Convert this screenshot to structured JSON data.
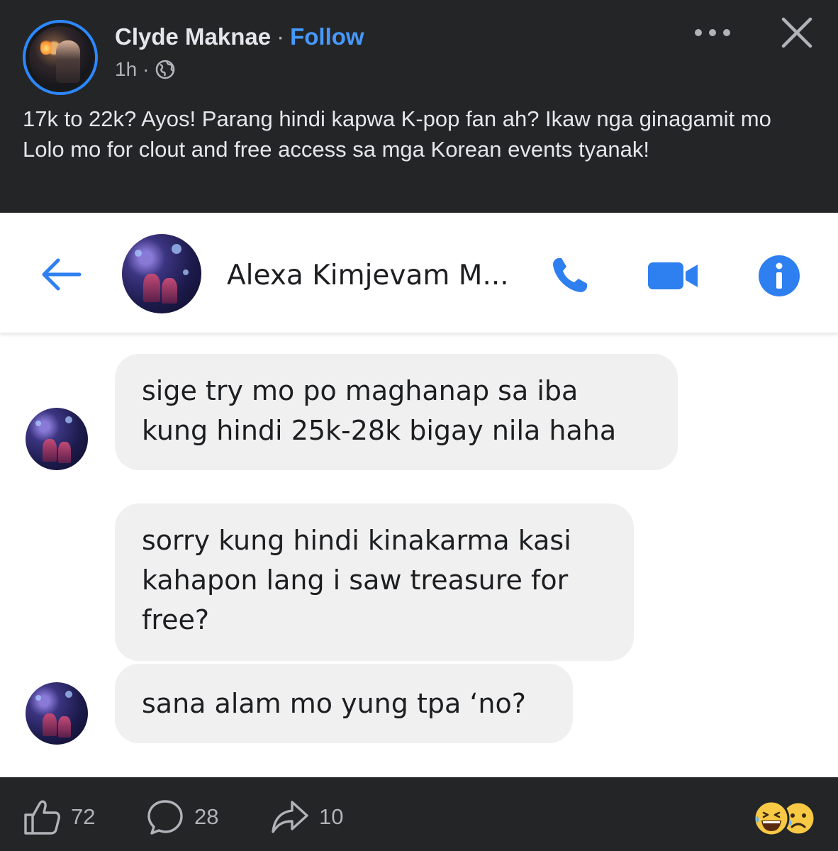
{
  "post": {
    "author": "Clyde Maknae",
    "separator": "·",
    "follow_label": "Follow",
    "time": "1h",
    "meta_separator": "·",
    "privacy_icon": "globe-icon",
    "body": "17k to 22k? Ayos! Parang hindi kapwa K-pop fan ah? Ikaw nga ginagamit mo Lolo mo for clout and free access sa mga Korean events tyanak!"
  },
  "screenshot": {
    "contact_name": "Alexa Kimjevam M...",
    "messages": [
      {
        "text": "sige try mo po maghanap sa iba\nkung hindi 25k-28k bigay nila haha"
      },
      {
        "text": "sorry kung hindi kinakarma kasi\nkahapon lang i saw treasure for\nfree?"
      },
      {
        "text": "sana alam mo yung tpa ‘no?"
      }
    ]
  },
  "footer": {
    "likes": "72",
    "comments": "28",
    "shares": "10"
  },
  "colors": {
    "background": "#242526",
    "accent": "#2d88ff",
    "messenger_blue": "#2e7ff0",
    "bubble": "#f1f0f0"
  }
}
